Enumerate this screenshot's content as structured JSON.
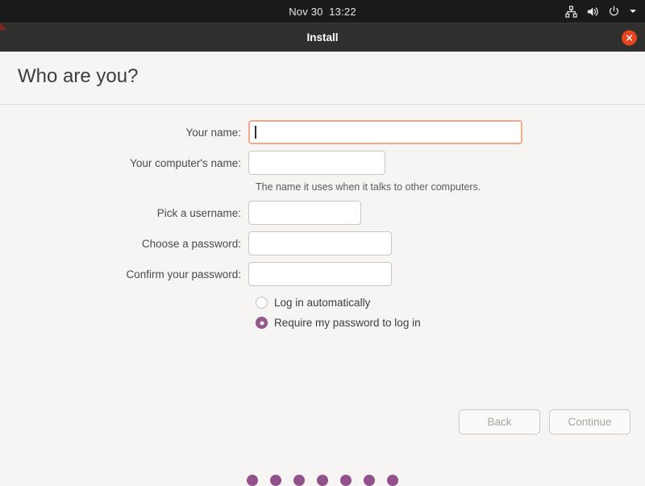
{
  "top_panel": {
    "clock": "Nov 30  13:22",
    "indicators": [
      {
        "name": "network-icon"
      },
      {
        "name": "volume-icon"
      },
      {
        "name": "power-icon"
      },
      {
        "name": "chevron-down-icon"
      }
    ]
  },
  "window": {
    "title": "Install",
    "close_label": "Close",
    "close_color": "#e8441f"
  },
  "page": {
    "heading": "Who are you?"
  },
  "form": {
    "fields": [
      {
        "label": "Your name:",
        "value": "",
        "placeholder": "",
        "name": "your-name",
        "focused": true,
        "width_class": "w-name",
        "type": "text"
      },
      {
        "label": "Your computer's name:",
        "value": "",
        "placeholder": "",
        "name": "computer-name",
        "focused": false,
        "width_class": "w-computer",
        "type": "text"
      },
      {
        "label": "Pick a username:",
        "value": "",
        "placeholder": "",
        "name": "username",
        "focused": false,
        "width_class": "w-username",
        "type": "text"
      },
      {
        "label": "Choose a password:",
        "value": "",
        "placeholder": "",
        "name": "password",
        "focused": false,
        "width_class": "w-password",
        "type": "password"
      },
      {
        "label": "Confirm your password:",
        "value": "",
        "placeholder": "",
        "name": "confirm-password",
        "focused": false,
        "width_class": "w-password",
        "type": "password"
      }
    ],
    "computer_name_hint": "The name it uses when it talks to other computers."
  },
  "login_options": {
    "accent_color": "#96568e",
    "options": [
      {
        "label": "Log in automatically",
        "selected": false
      },
      {
        "label": "Require my password to log in",
        "selected": true
      }
    ]
  },
  "buttons": {
    "back": "Back",
    "continue": "Continue"
  },
  "progress": {
    "dot_count": 7,
    "dot_color": "#92518b"
  }
}
